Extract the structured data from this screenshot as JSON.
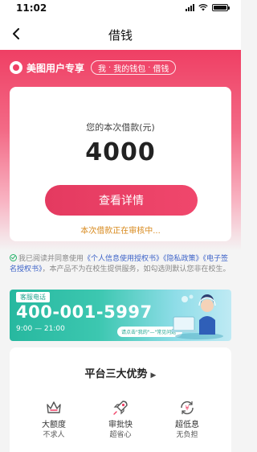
{
  "status_bar": {
    "time": "11:02"
  },
  "nav": {
    "title": "借钱"
  },
  "brand": {
    "name": "美图用户专享",
    "breadcrumb": [
      "我",
      "我的钱包",
      "借钱"
    ],
    "breadcrumb_sep": "·"
  },
  "loan": {
    "label": "您的本次借款(元)",
    "amount": "4000",
    "detail_button": "查看详情",
    "status": "本次借款正在审核中..."
  },
  "agreement": {
    "prefix": "我已阅读并同意使用",
    "link1": "《个人信息使用授权书》",
    "link2": "《隐私政策》",
    "link3": "《电子签名授权书》",
    "suffix": "，本产品不为在校生提供服务，如勾选则默认您非在校生。"
  },
  "service": {
    "tag": "客服电话",
    "phone": "400-001-5997",
    "hours": "9:00 — 21:00",
    "hint": "请点击\"我的\"—\"常见问题\""
  },
  "advantages": {
    "title": "平台三大优势",
    "items": [
      {
        "icon": "crown-icon",
        "main": "大额度",
        "sub": "不求人"
      },
      {
        "icon": "rocket-icon",
        "main": "审批快",
        "sub": "超省心"
      },
      {
        "icon": "yen-cycle-icon",
        "main": "超低息",
        "sub": "无负担"
      }
    ]
  },
  "colors": {
    "brand_pink": "#ef3f64",
    "status_orange": "#d88a1e",
    "link_blue": "#3d63c8",
    "service_teal": "#27b89f"
  }
}
